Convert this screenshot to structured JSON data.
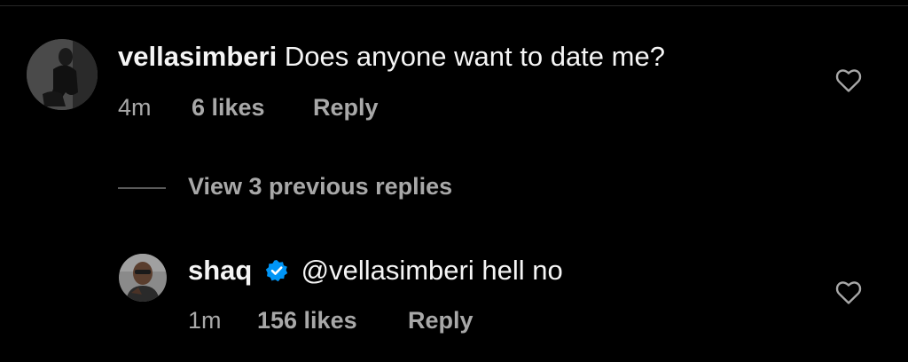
{
  "comment": {
    "username": "vellasimberi",
    "text": "Does anyone want to date me?",
    "time": "4m",
    "likes": "6 likes",
    "reply_label": "Reply",
    "avatar_icon": "profile-photo"
  },
  "view_replies": {
    "label": "View 3 previous replies"
  },
  "reply": {
    "username": "shaq",
    "verified": true,
    "text": "@vellasimberi hell no",
    "time": "1m",
    "likes": "156 likes",
    "reply_label": "Reply",
    "avatar_icon": "profile-photo"
  },
  "colors": {
    "background": "#000000",
    "primary_text": "#f5f5f5",
    "secondary_text": "#a8a8a8",
    "verified_badge": "#0095f6",
    "heart_stroke": "#a8a8a8"
  }
}
